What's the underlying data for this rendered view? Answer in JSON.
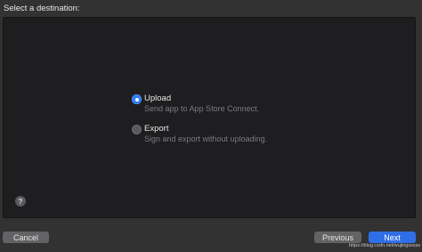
{
  "dialog": {
    "heading": "Select a destination:"
  },
  "options": [
    {
      "title": "Upload",
      "description": "Send app to App Store Connect.",
      "selected": true
    },
    {
      "title": "Export",
      "description": "Sign and export without uploading.",
      "selected": false
    }
  ],
  "help": {
    "glyph": "?"
  },
  "buttons": {
    "cancel": "Cancel",
    "previous": "Previous",
    "next": "Next"
  },
  "watermark": "https://blog.csdn.net/wujingsssss",
  "colors": {
    "accent": "#2f7cf6",
    "background": "#323232",
    "panel": "#1e1e20"
  }
}
